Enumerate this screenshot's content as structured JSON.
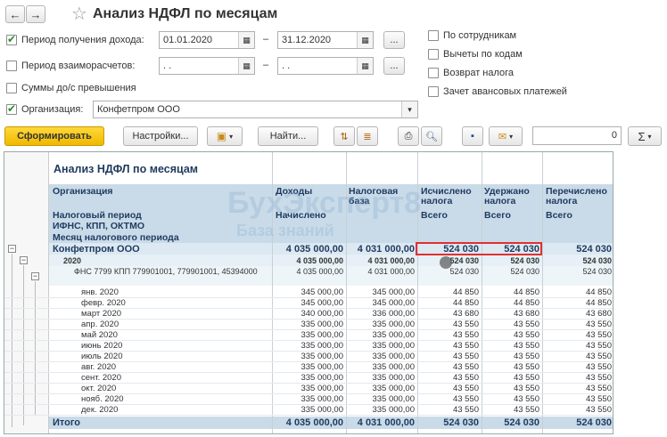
{
  "header": {
    "title": "Анализ НДФЛ по месяцам",
    "back": "←",
    "forward": "→",
    "star": "☆"
  },
  "filters": {
    "period_income_label": "Период получения дохода:",
    "period_income_from": "01.01.2020",
    "period_income_to": "31.12.2020",
    "dash": "–",
    "period_settle_label": "Период взаиморасчетов:",
    "period_settle_from": " .  .",
    "period_settle_to": " .  .",
    "sums_label": "Суммы до/с превышения",
    "org_label": "Организация:",
    "org_value": "Конфетпром ООО",
    "dots": "...",
    "by_employees": "По сотрудникам",
    "deductions_by_codes": "Вычеты по кодам",
    "tax_refund": "Возврат налога",
    "advance_offset": "Зачет авансовых платежей"
  },
  "toolbar": {
    "generate": "Сформировать",
    "settings": "Настройки...",
    "find": "Найти...",
    "counter": "0",
    "sigma": "Σ"
  },
  "report": {
    "title": "Анализ НДФЛ по месяцам",
    "col_org": "Организация",
    "col_period": "Налоговый период",
    "col_ifns": "ИФНС, КПП, ОКТМО",
    "col_month": "Месяц налогового периода",
    "col_income": "Доходы",
    "col_income_sub": "Начислено",
    "col_base": "Налоговая база",
    "col_calc": "Исчислено налога",
    "col_calc_sub": "Всего",
    "col_withheld": "Удержано налога",
    "col_withheld_sub": "Всего",
    "col_paid": "Перечислено налога",
    "col_paid_sub": "Всего",
    "org_row": {
      "name": "Конфетпром ООО",
      "income": "4 035 000,00",
      "base": "4 031 000,00",
      "calc": "524 030",
      "withheld": "524 030",
      "paid": "524 030"
    },
    "year_row": {
      "name": "2020",
      "income": "4 035 000,00",
      "base": "4 031 000,00",
      "calc": "524 030",
      "withheld": "524 030",
      "paid": "524 030"
    },
    "ifns_row": {
      "name": "ФНС 7799 КПП 779901001, 779901001, 45394000",
      "income": "4 035 000,00",
      "base": "4 031 000,00",
      "calc": "524 030",
      "withheld": "524 030",
      "paid": "524 030"
    },
    "months": [
      {
        "name": "янв. 2020",
        "income": "345 000,00",
        "base": "345 000,00",
        "calc": "44 850",
        "withheld": "44 850",
        "paid": "44 850"
      },
      {
        "name": "февр. 2020",
        "income": "345 000,00",
        "base": "345 000,00",
        "calc": "44 850",
        "withheld": "44 850",
        "paid": "44 850"
      },
      {
        "name": "март 2020",
        "income": "340 000,00",
        "base": "336 000,00",
        "calc": "43 680",
        "withheld": "43 680",
        "paid": "43 680"
      },
      {
        "name": "апр. 2020",
        "income": "335 000,00",
        "base": "335 000,00",
        "calc": "43 550",
        "withheld": "43 550",
        "paid": "43 550"
      },
      {
        "name": "май 2020",
        "income": "335 000,00",
        "base": "335 000,00",
        "calc": "43 550",
        "withheld": "43 550",
        "paid": "43 550"
      },
      {
        "name": "июнь 2020",
        "income": "335 000,00",
        "base": "335 000,00",
        "calc": "43 550",
        "withheld": "43 550",
        "paid": "43 550"
      },
      {
        "name": "июль 2020",
        "income": "335 000,00",
        "base": "335 000,00",
        "calc": "43 550",
        "withheld": "43 550",
        "paid": "43 550"
      },
      {
        "name": "авг. 2020",
        "income": "335 000,00",
        "base": "335 000,00",
        "calc": "43 550",
        "withheld": "43 550",
        "paid": "43 550"
      },
      {
        "name": "сент. 2020",
        "income": "335 000,00",
        "base": "335 000,00",
        "calc": "43 550",
        "withheld": "43 550",
        "paid": "43 550"
      },
      {
        "name": "окт. 2020",
        "income": "335 000,00",
        "base": "335 000,00",
        "calc": "43 550",
        "withheld": "43 550",
        "paid": "43 550"
      },
      {
        "name": "нояб. 2020",
        "income": "335 000,00",
        "base": "335 000,00",
        "calc": "43 550",
        "withheld": "43 550",
        "paid": "43 550"
      },
      {
        "name": "дек. 2020",
        "income": "335 000,00",
        "base": "335 000,00",
        "calc": "43 550",
        "withheld": "43 550",
        "paid": "43 550"
      }
    ],
    "total_row": {
      "name": "Итого",
      "income": "4 035 000,00",
      "base": "4 031 000,00",
      "calc": "524 030",
      "withheld": "524 030",
      "paid": "524 030"
    }
  },
  "watermark": {
    "line1": "БухЭксперт8",
    "line2": "База знаний"
  },
  "colors": {
    "accent_yellow": "#f5c400",
    "header_blue": "#c9dbe8",
    "highlight_red": "#e03030",
    "title_blue": "#1f3a5f"
  }
}
